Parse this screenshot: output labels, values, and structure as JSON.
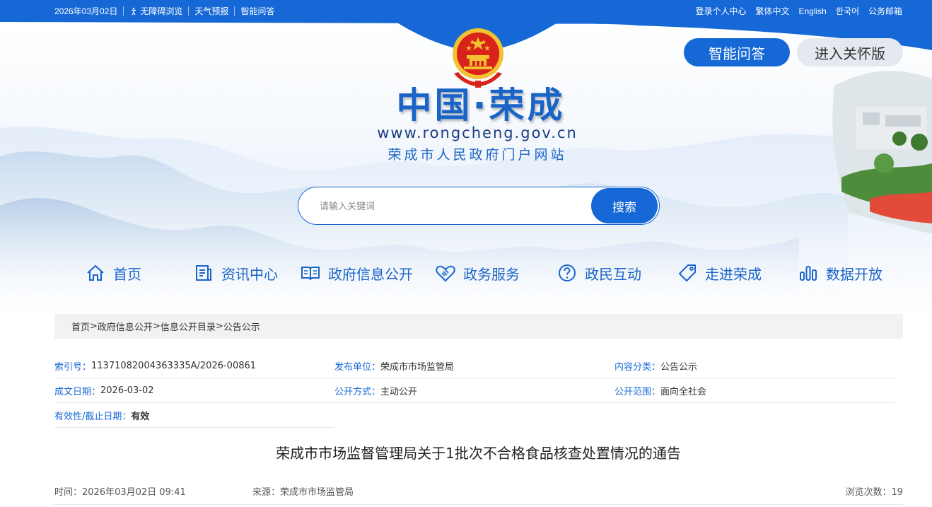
{
  "topbar": {
    "date": "2026年03月02日",
    "accessibility": "无障碍浏览",
    "weather": "天气预报",
    "qa": "智能问答",
    "right_links": [
      "登录个人中心",
      "繁体中文",
      "English",
      "한국어",
      "公务邮箱"
    ]
  },
  "banner": {
    "qa_button": "智能问答",
    "care_button": "进入关怀版",
    "title": "中国·荣成",
    "url": "www.rongcheng.gov.cn",
    "subtitle": "荣成市人民政府门户网站"
  },
  "search": {
    "placeholder": "请输入关键词",
    "button": "搜索"
  },
  "nav": {
    "items": [
      {
        "label": "首页",
        "icon": "home-icon"
      },
      {
        "label": "资讯中心",
        "icon": "news-icon"
      },
      {
        "label": "政府信息公开",
        "icon": "book-icon"
      },
      {
        "label": "政务服务",
        "icon": "handshake-icon"
      },
      {
        "label": "政民互动",
        "icon": "question-icon"
      },
      {
        "label": "走进荣成",
        "icon": "tag-icon"
      },
      {
        "label": "数据开放",
        "icon": "bar-chart-icon"
      }
    ]
  },
  "breadcrumb": [
    "首页",
    "政府信息公开",
    "信息公开目录",
    "公告公示"
  ],
  "meta": {
    "index_label": "索引号：",
    "index_value": "11371082004363335A/2026-00861",
    "publisher_label": "发布单位：",
    "publisher_value": "荣成市市场监管局",
    "category_label": "内容分类：",
    "category_value": "公告公示",
    "date_label": "成文日期：",
    "date_value": "2026-03-02",
    "method_label": "公开方式：",
    "method_value": "主动公开",
    "scope_label": "公开范围：",
    "scope_value": "面向全社会",
    "validity_label": "有效性/截止日期：",
    "validity_value": "有效"
  },
  "article": {
    "title": "荣成市市场监督管理局关于1批次不合格食品核查处置情况的通告",
    "time": "时间：2026年03月02日 09:41",
    "source": "来源：荣成市市场监管局",
    "views": "浏览次数：19"
  },
  "colors": {
    "primary": "#1668d6",
    "title_blue": "#1a64c8",
    "emblem_red": "#d8221a",
    "emblem_gold": "#f2c230"
  }
}
